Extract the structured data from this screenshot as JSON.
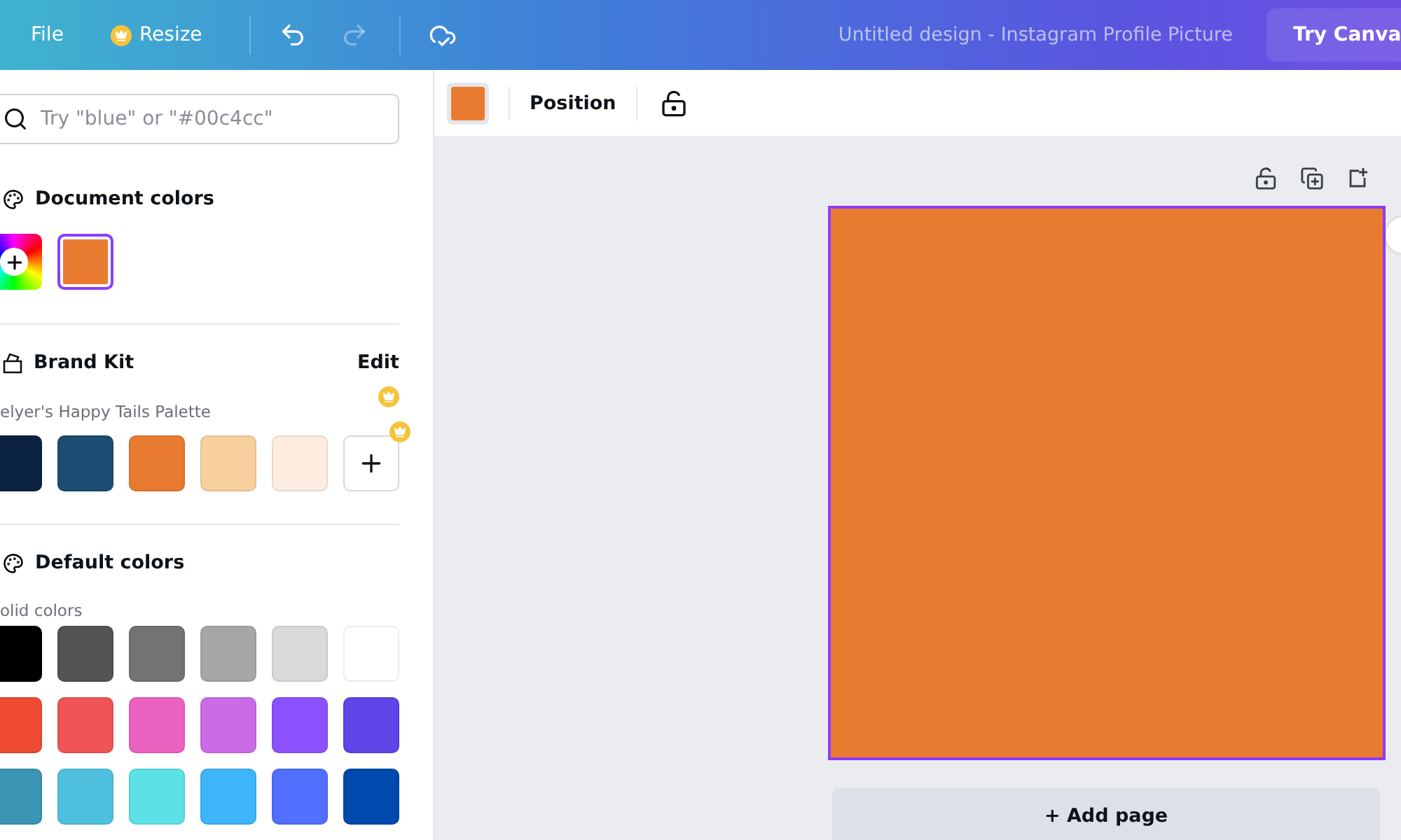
{
  "topbar": {
    "menu": [
      {
        "kind": "text",
        "label": "File"
      },
      {
        "kind": "premium",
        "label": "Resize"
      }
    ],
    "history": [
      {
        "kind": "undo",
        "disabled": false
      },
      {
        "kind": "redo",
        "disabled": true
      }
    ],
    "title": "Untitled design - Instagram Profile Picture",
    "cta": "Try Canva"
  },
  "search": {
    "placeholder": "Try \"blue\" or \"#00c4cc\""
  },
  "document_colors": {
    "title": "Document colors",
    "swatches": [
      {
        "kind": "add"
      },
      {
        "kind": "color",
        "color": "#e87b2f",
        "selected": true
      }
    ]
  },
  "brand_kit": {
    "title": "Brand Kit",
    "action": "Edit",
    "palette_name": "elyer's Happy Tails Palette",
    "swatches": [
      {
        "kind": "color",
        "color": "#0b2341"
      },
      {
        "kind": "color",
        "color": "#1b4e72"
      },
      {
        "kind": "color",
        "color": "#e87b2f"
      },
      {
        "kind": "color",
        "color": "#f8d09e"
      },
      {
        "kind": "color",
        "color": "#fcede0"
      },
      {
        "kind": "add"
      }
    ]
  },
  "default_colors": {
    "title": "Default colors",
    "subtitle": "olid colors",
    "swatches": [
      {
        "color": "#000000"
      },
      {
        "color": "#545454"
      },
      {
        "color": "#737373"
      },
      {
        "color": "#a6a6a6"
      },
      {
        "color": "#d9d9d9"
      },
      {
        "color": "#ffffff"
      },
      {
        "color": "#ee4a32"
      },
      {
        "color": "#f05455"
      },
      {
        "color": "#ec62c1"
      },
      {
        "color": "#cb6ce6"
      },
      {
        "color": "#8c52ff"
      },
      {
        "color": "#5e46e8"
      },
      {
        "color": "#3a95b4"
      },
      {
        "color": "#4ec0de"
      },
      {
        "color": "#5ce1e6"
      },
      {
        "color": "#3db7f9"
      },
      {
        "color": "#5170ff"
      },
      {
        "color": "#004aad"
      }
    ]
  },
  "editor_toolbar": {
    "color": "#e87b2f",
    "position": "Position"
  },
  "canvas": {
    "color": "#e87b2f",
    "selected": true,
    "add_page": "+ Add page"
  }
}
